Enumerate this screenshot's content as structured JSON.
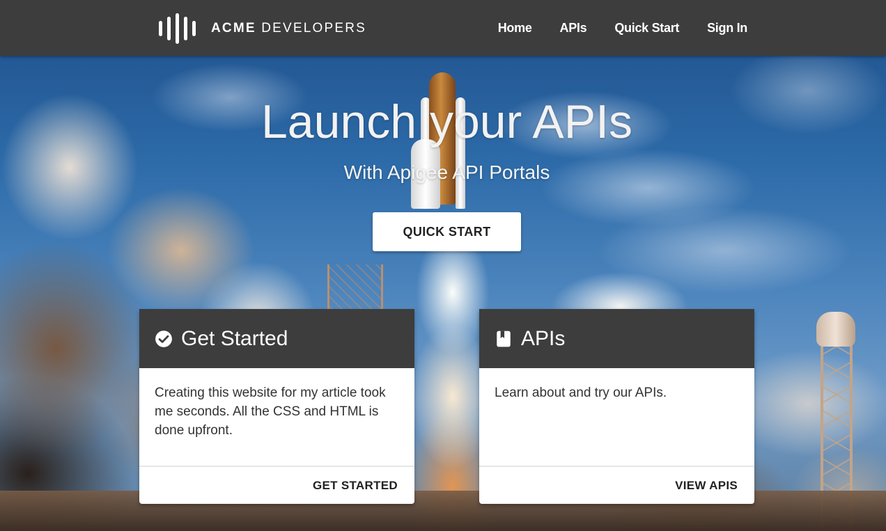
{
  "header": {
    "logo_text_bold": "ACME",
    "logo_text_rest": " DEVELOPERS",
    "nav": [
      {
        "label": "Home"
      },
      {
        "label": "APIs"
      },
      {
        "label": "Quick Start"
      },
      {
        "label": "Sign In"
      }
    ]
  },
  "hero": {
    "title": "Launch your APIs",
    "subtitle": "With Apigee API Portals",
    "cta_label": "QUICK START"
  },
  "cards": [
    {
      "title": "Get Started",
      "icon": "check-circle-icon",
      "body": "Creating this website for my article took me seconds. All the CSS and HTML is done upfront.",
      "action_label": "GET STARTED"
    },
    {
      "title": "APIs",
      "icon": "book-icon",
      "body": "Learn about and try our APIs.",
      "action_label": "VIEW APIS"
    }
  ],
  "colors": {
    "header_bg": "#3d3d3d",
    "card_header_bg": "#3d3d3d",
    "text_light": "#ffffff",
    "text_dark": "#222222"
  }
}
